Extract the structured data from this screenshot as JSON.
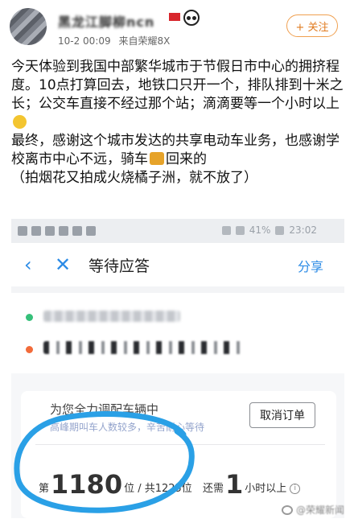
{
  "post": {
    "username": "黑龙江脚柳ncn",
    "timestamp": "10-2 00:09",
    "source": "来自荣耀8X",
    "follow_label": "+ 关注",
    "text_line1": "今天体验到我国中部繁华城市于节假日市中心的拥挤程度。10点打算回去，地铁口只开一个，排队排到十米之长；公交车直接不经过那个站；滴滴要等一个小时以上",
    "text_line2": "最终，感谢这个城市发达的共享电动车业务，也感谢学校离市中心不远，骑车",
    "text_line2_tail": "回来的",
    "text_line3": "（拍烟花又拍成火烧橘子洲，就不放了）"
  },
  "status_bar": {
    "battery": "41%",
    "time": "23:02"
  },
  "app": {
    "back_icon": "‹",
    "close_icon": "✕",
    "title": "等待应答",
    "share_label": "分享"
  },
  "dispatch": {
    "title": "为您全力调配车辆中",
    "subtitle": "高峰期叫车人数较多，辛苦耐心等待",
    "cancel_label": "取消订单",
    "queue_prefix": "第",
    "queue_position": "1180",
    "queue_suffix": "位 / 共1225位",
    "wait_prefix": "还需",
    "wait_value": "1",
    "wait_suffix": "小时以上"
  },
  "watermark": "@荣耀新闻"
}
